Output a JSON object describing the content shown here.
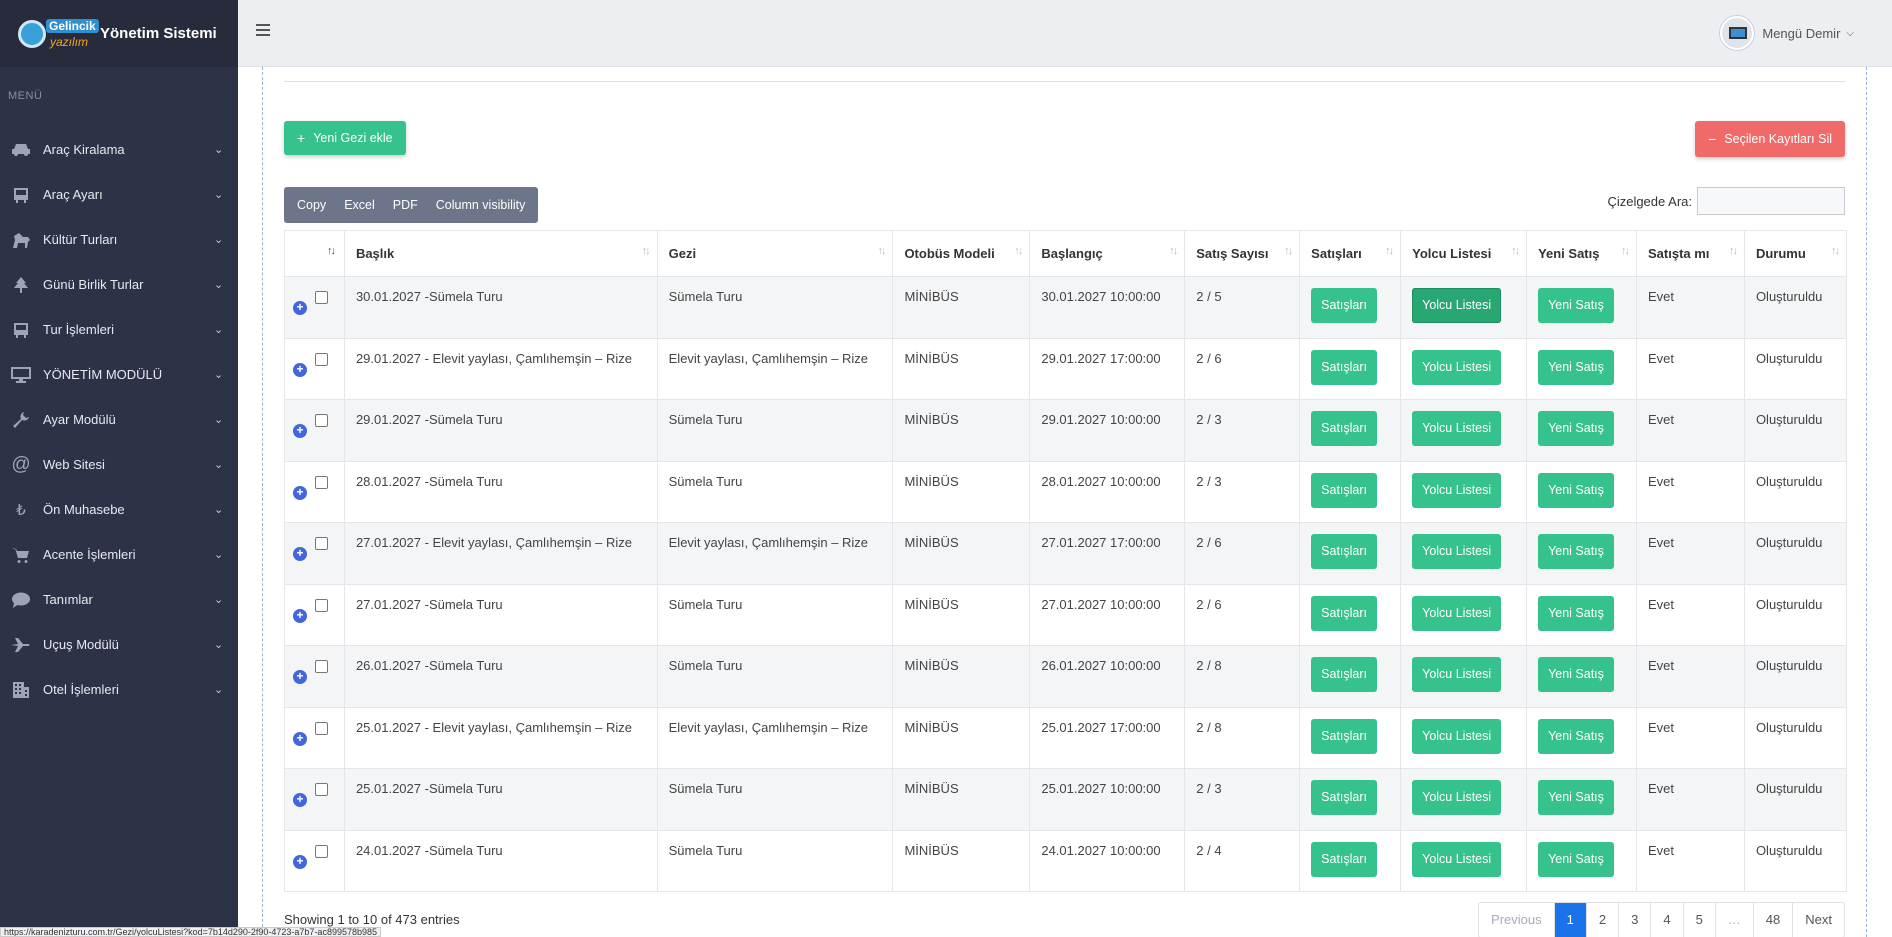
{
  "brand": {
    "logo_line1": "Gelincik",
    "logo_line2": "yazılım",
    "title": "Yönetim Sistemi"
  },
  "sidebar": {
    "menu_label": "MENÜ",
    "items": [
      {
        "label": "Araç Kiralama",
        "icon": "car-icon"
      },
      {
        "label": "Araç Ayarı",
        "icon": "bus-icon"
      },
      {
        "label": "Kültür Turları",
        "icon": "horse-icon"
      },
      {
        "label": "Günü Birlik Turlar",
        "icon": "tree-icon"
      },
      {
        "label": "Tur İşlemleri",
        "icon": "bus-icon"
      },
      {
        "label": "YÖNETİM MODÜLÜ",
        "icon": "desktop-icon"
      },
      {
        "label": "Ayar Modülü",
        "icon": "wrench-icon"
      },
      {
        "label": "Web Sitesi",
        "icon": "at-icon"
      },
      {
        "label": "Ön Muhasebe",
        "icon": "lira-icon"
      },
      {
        "label": "Acente İşlemleri",
        "icon": "cart-icon"
      },
      {
        "label": "Tanımlar",
        "icon": "comment-icon"
      },
      {
        "label": "Uçuş Modülü",
        "icon": "plane-icon"
      },
      {
        "label": "Otel İşlemleri",
        "icon": "building-icon"
      }
    ]
  },
  "user": {
    "name": "Mengü Demir"
  },
  "toolbar": {
    "add_label": "Yeni Gezi ekle",
    "delete_label": "Seçilen Kayıtları Sil",
    "export_buttons": [
      "Copy",
      "Excel",
      "PDF",
      "Column visibility"
    ],
    "search_label": "Çizelgede Ara:",
    "search_value": ""
  },
  "table": {
    "columns": [
      "Başlık",
      "Gezi",
      "Otobüs Modeli",
      "Başlangıç",
      "Satış Sayısı",
      "Satışları",
      "Yolcu Listesi",
      "Yeni Satış",
      "Satışta mı",
      "Durumu"
    ],
    "button_labels": {
      "sales": "Satışları",
      "passengers": "Yolcu Listesi",
      "new_sale": "Yeni Satış"
    },
    "rows": [
      {
        "title": "30.01.2027 -Sümela Turu",
        "tour": "Sümela Turu",
        "bus": "MİNİBÜS",
        "start": "30.01.2027 10:00:00",
        "sales_count": "2 / 5",
        "on_sale": "Evet",
        "status": "Oluşturuldu"
      },
      {
        "title": "29.01.2027 - Elevit yaylası, Çamlıhemşin – Rize",
        "tour": "Elevit yaylası, Çamlıhemşin – Rize",
        "bus": "MİNİBÜS",
        "start": "29.01.2027 17:00:00",
        "sales_count": "2 / 6",
        "on_sale": "Evet",
        "status": "Oluşturuldu"
      },
      {
        "title": "29.01.2027 -Sümela Turu",
        "tour": "Sümela Turu",
        "bus": "MİNİBÜS",
        "start": "29.01.2027 10:00:00",
        "sales_count": "2 / 3",
        "on_sale": "Evet",
        "status": "Oluşturuldu"
      },
      {
        "title": "28.01.2027 -Sümela Turu",
        "tour": "Sümela Turu",
        "bus": "MİNİBÜS",
        "start": "28.01.2027 10:00:00",
        "sales_count": "2 / 3",
        "on_sale": "Evet",
        "status": "Oluşturuldu"
      },
      {
        "title": "27.01.2027 - Elevit yaylası, Çamlıhemşin – Rize",
        "tour": "Elevit yaylası, Çamlıhemşin – Rize",
        "bus": "MİNİBÜS",
        "start": "27.01.2027 17:00:00",
        "sales_count": "2 / 6",
        "on_sale": "Evet",
        "status": "Oluşturuldu"
      },
      {
        "title": "27.01.2027 -Sümela Turu",
        "tour": "Sümela Turu",
        "bus": "MİNİBÜS",
        "start": "27.01.2027 10:00:00",
        "sales_count": "2 / 6",
        "on_sale": "Evet",
        "status": "Oluşturuldu"
      },
      {
        "title": "26.01.2027 -Sümela Turu",
        "tour": "Sümela Turu",
        "bus": "MİNİBÜS",
        "start": "26.01.2027 10:00:00",
        "sales_count": "2 / 8",
        "on_sale": "Evet",
        "status": "Oluşturuldu"
      },
      {
        "title": "25.01.2027 - Elevit yaylası, Çamlıhemşin – Rize",
        "tour": "Elevit yaylası, Çamlıhemşin – Rize",
        "bus": "MİNİBÜS",
        "start": "25.01.2027 17:00:00",
        "sales_count": "2 / 8",
        "on_sale": "Evet",
        "status": "Oluşturuldu"
      },
      {
        "title": "25.01.2027 -Sümela Turu",
        "tour": "Sümela Turu",
        "bus": "MİNİBÜS",
        "start": "25.01.2027 10:00:00",
        "sales_count": "2 / 3",
        "on_sale": "Evet",
        "status": "Oluşturuldu"
      },
      {
        "title": "24.01.2027 -Sümela Turu",
        "tour": "Sümela Turu",
        "bus": "MİNİBÜS",
        "start": "24.01.2027 10:00:00",
        "sales_count": "2 / 4",
        "on_sale": "Evet",
        "status": "Oluşturuldu"
      }
    ]
  },
  "footer": {
    "info": "Showing 1 to 10 of 473 entries",
    "pagination": [
      "Previous",
      "1",
      "2",
      "3",
      "4",
      "5",
      "…",
      "48",
      "Next"
    ],
    "active_page": "1"
  },
  "statusbar": {
    "url": "https://karadenizturu.com.tr/Gezi/yolcuListesi?kod=7b14d290-2f90-4723-a7b7-ac899578b985"
  },
  "colors": {
    "sidebar": "#2d3247",
    "accent_green": "#35c28d",
    "danger": "#f06a6a",
    "active_page": "#1a73e8"
  }
}
